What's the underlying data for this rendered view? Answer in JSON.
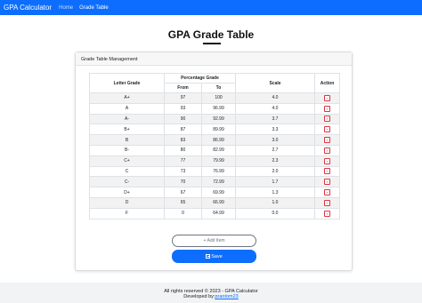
{
  "navbar": {
    "brand": "GPA Calculator",
    "links": [
      {
        "label": "Home"
      },
      {
        "label": "Grade Table"
      }
    ]
  },
  "page": {
    "title": "GPA Grade Table"
  },
  "card": {
    "header": "Grade Table Management",
    "table": {
      "headers": {
        "letter_grade": "Letter Grade",
        "percentage_grade": "Percentage Grade",
        "from": "From",
        "to": "To",
        "scale": "Scale",
        "action": "Action"
      },
      "rows": [
        {
          "letter": "A+",
          "from": "97",
          "to": "100",
          "scale": "4.0"
        },
        {
          "letter": "A",
          "from": "93",
          "to": "96.99",
          "scale": "4.0"
        },
        {
          "letter": "A-",
          "from": "90",
          "to": "92.99",
          "scale": "3.7"
        },
        {
          "letter": "B+",
          "from": "87",
          "to": "89.99",
          "scale": "3.3"
        },
        {
          "letter": "B",
          "from": "83",
          "to": "86.99",
          "scale": "3.0"
        },
        {
          "letter": "B-",
          "from": "80",
          "to": "82.99",
          "scale": "2.7"
        },
        {
          "letter": "C+",
          "from": "77",
          "to": "79.99",
          "scale": "2.3"
        },
        {
          "letter": "C",
          "from": "73",
          "to": "76.99",
          "scale": "2.0"
        },
        {
          "letter": "C-",
          "from": "70",
          "to": "72.99",
          "scale": "1.7"
        },
        {
          "letter": "D+",
          "from": "67",
          "to": "69.99",
          "scale": "1.3"
        },
        {
          "letter": "D",
          "from": "65",
          "to": "66.99",
          "scale": "1.0"
        },
        {
          "letter": "F",
          "from": "0",
          "to": "64.99",
          "scale": "0.0"
        }
      ],
      "delete_icon": "x-icon",
      "delete_glyph": "×"
    },
    "add_label": "+ Add Item",
    "save_label": "Save",
    "save_icon": "floppy-disk-icon"
  },
  "footer": {
    "copyright": "All rights reserved © 2023 - GPA Calculator",
    "developed_by": "Developed by:",
    "developer": "prantom23"
  },
  "colors": {
    "navbar": "#0d6efd",
    "primary_button": "#0d6efd",
    "danger": "#dc3545",
    "footer_bg": "#f1f3f5"
  }
}
